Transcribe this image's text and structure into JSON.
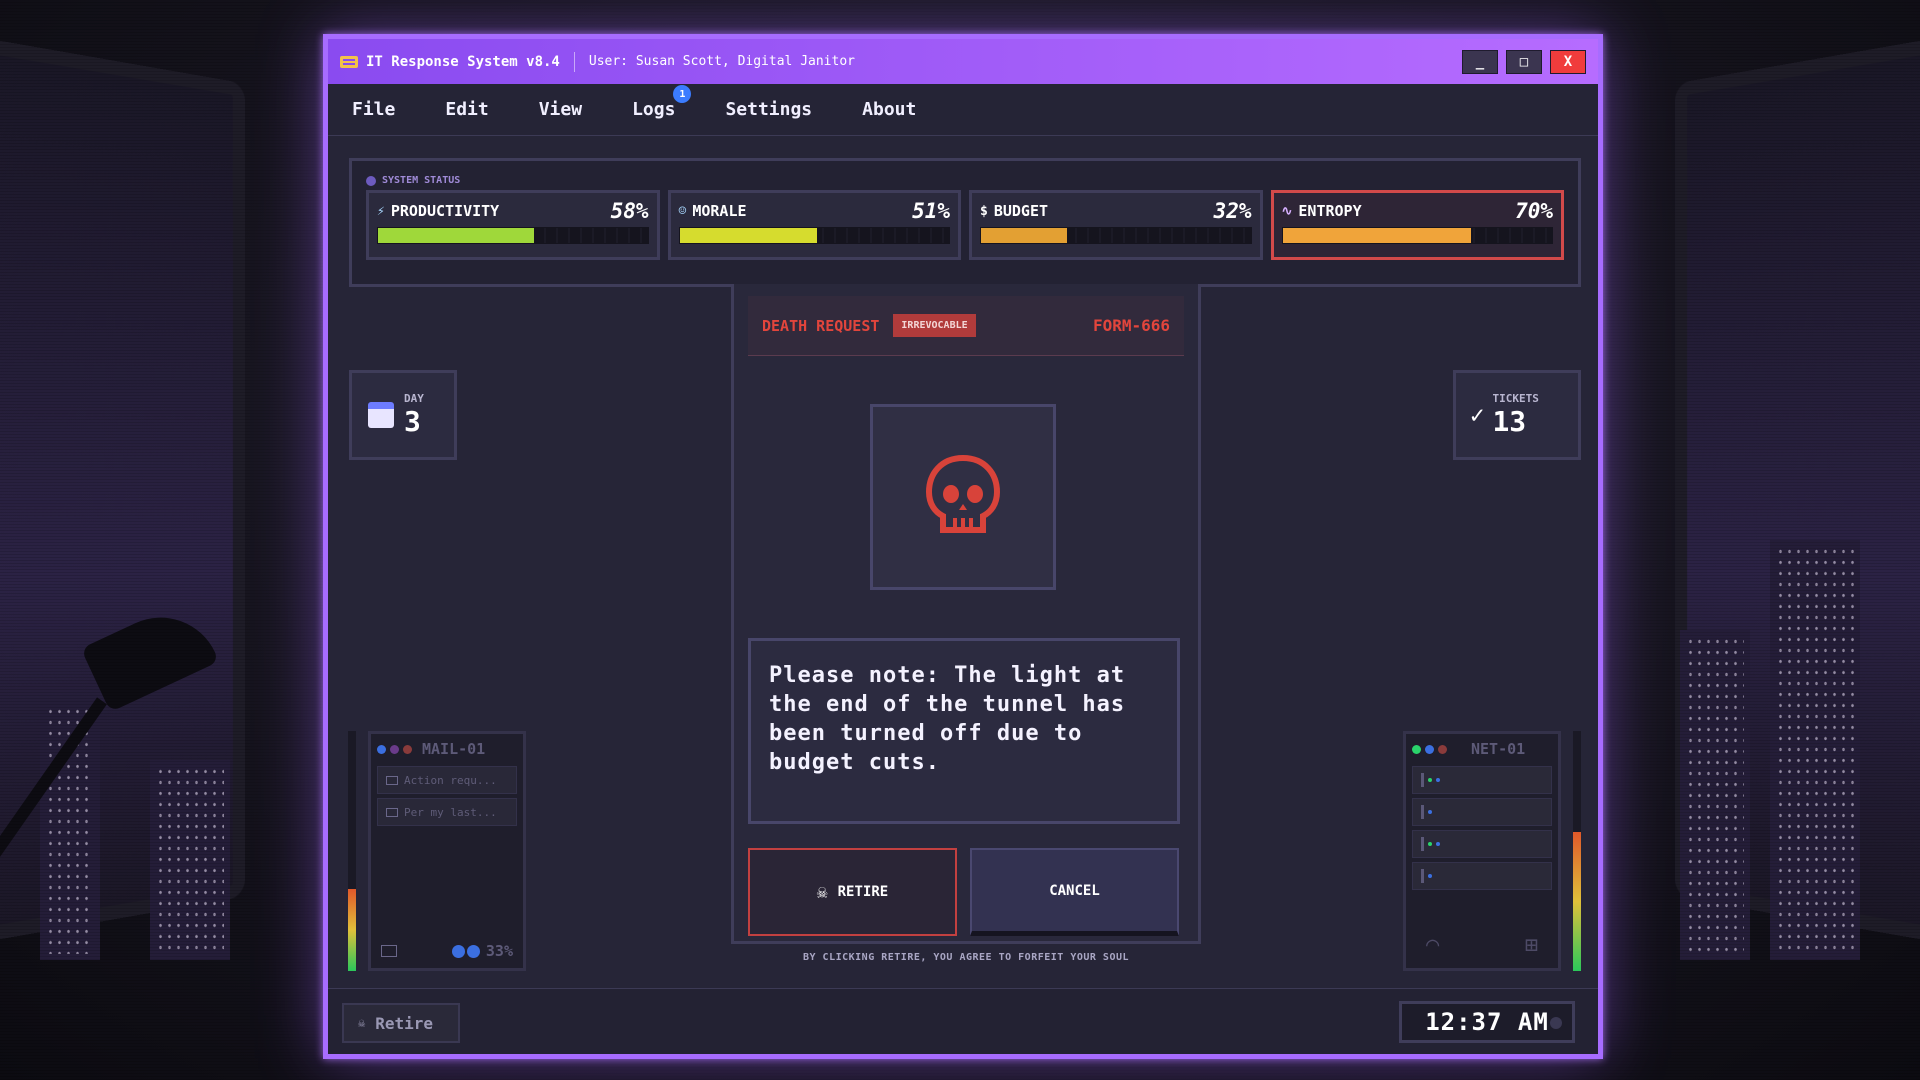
{
  "window": {
    "title": "IT Response System v8.4",
    "user": "User: Susan Scott, Digital Janitor",
    "controls": {
      "minimize": "_",
      "maximize": "□",
      "close": "X"
    }
  },
  "menu": {
    "items": [
      "File",
      "Edit",
      "View",
      "Logs",
      "Settings",
      "About"
    ],
    "logs_badge": "1"
  },
  "status": {
    "title": "SYSTEM STATUS",
    "meters": [
      {
        "name": "PRODUCTIVITY",
        "icon": "bolt-icon",
        "value_label": "58%",
        "value": 0.58,
        "color": "#9fd83a"
      },
      {
        "name": "MORALE",
        "icon": "person-icon",
        "value_label": "51%",
        "value": 0.51,
        "color": "#d6dc2e"
      },
      {
        "name": "BUDGET",
        "icon": "dollar-icon",
        "value_label": "32%",
        "value": 0.32,
        "color": "#e3a033"
      },
      {
        "name": "ENTROPY",
        "icon": "pulse-icon",
        "value_label": "70%",
        "value": 0.7,
        "color": "#f0a43a",
        "alert": true
      }
    ]
  },
  "day": {
    "label": "DAY",
    "value": "3"
  },
  "tickets": {
    "label": "TICKETS",
    "value": "13"
  },
  "mail": {
    "title": "MAIL-01",
    "items": [
      "Action requ...",
      "Per my last..."
    ],
    "percent": "33%"
  },
  "net": {
    "title": "NET-01"
  },
  "vu": {
    "left_level": 0.34,
    "right_level": 0.58
  },
  "dialog": {
    "title": "DEATH REQUEST",
    "tag": "IRREVOCABLE",
    "form_id": "FORM-666",
    "message": "Please note: The light at the end of the tunnel has been turned off due to budget cuts.",
    "retire_label": "RETIRE",
    "cancel_label": "CANCEL",
    "disclaimer": "BY CLICKING RETIRE, YOU AGREE TO FORFEIT YOUR SOUL"
  },
  "footer": {
    "retire_label": "Retire",
    "clock": "12:37 AM"
  },
  "colors": {
    "accent": "#a76cff",
    "danger": "#e2453c"
  }
}
